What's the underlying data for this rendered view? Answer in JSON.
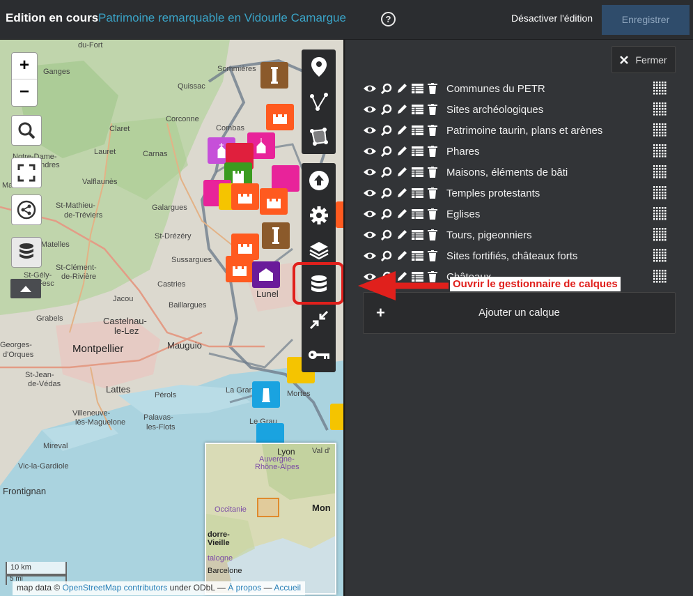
{
  "topbar": {
    "edition_label": "Edition en cours",
    "project_name": "Patrimoine remarquable en Vidourle Camargue",
    "help_label": "?",
    "disable_edit_label": "Désactiver l'édition",
    "save_label": "Enregistrer"
  },
  "map": {
    "zoom_in_label": "+",
    "zoom_out_label": "−",
    "places": [
      {
        "name": "du-Fort"
      },
      {
        "name": "Ganges"
      },
      {
        "name": "Quissac"
      },
      {
        "name": "Claret"
      },
      {
        "name": "Corconne"
      },
      {
        "name": "Combas"
      },
      {
        "name": "Lauret"
      },
      {
        "name": "Carnas"
      },
      {
        "name": "Notre-Dame-"
      },
      {
        "name": "de-Londres"
      },
      {
        "name": "Valflaunès"
      },
      {
        "name": "Martin-"
      },
      {
        "name": "St-Mathieu-"
      },
      {
        "name": "de-Tréviers"
      },
      {
        "name": "Galargues"
      },
      {
        "name": "St-Drézéry"
      },
      {
        "name": "Les Matelles"
      },
      {
        "name": "St-Clément-"
      },
      {
        "name": "de-Rivière"
      },
      {
        "name": "St-Gély-"
      },
      {
        "name": "du-Fesc"
      },
      {
        "name": "Sussargues"
      },
      {
        "name": "Castries"
      },
      {
        "name": "Jacou"
      },
      {
        "name": "Baillargues"
      },
      {
        "name": "Grabels"
      },
      {
        "name": "Castelnau-"
      },
      {
        "name": "le-Lez"
      },
      {
        "name": "Lunel"
      },
      {
        "name": "Montpellier"
      },
      {
        "name": "Mauguio"
      },
      {
        "name": "Georges-"
      },
      {
        "name": "d'Orques"
      },
      {
        "name": "St-Jean-"
      },
      {
        "name": "de-Védas"
      },
      {
        "name": "Lattes"
      },
      {
        "name": "Pérols"
      },
      {
        "name": "La Grande"
      },
      {
        "name": "Villeneuve-"
      },
      {
        "name": "lès-Maguelone"
      },
      {
        "name": "Palavas-"
      },
      {
        "name": "les-Flots"
      },
      {
        "name": "Le Grau"
      },
      {
        "name": "Mireval"
      },
      {
        "name": "Vic-la-Gardiole"
      },
      {
        "name": "Frontignan"
      },
      {
        "name": "Mortes"
      },
      {
        "name": "Sommières"
      }
    ],
    "minimap": {
      "places": [
        "Lyon",
        "Auvergne-",
        "Rhône-Alpes",
        "Val d'",
        "Occitanie",
        "Mon",
        "dorre-",
        "Vieille",
        "talogne",
        "Barcelone"
      ]
    },
    "scale_label": "10 km",
    "scale_label_2": "5 mi",
    "attribution": {
      "prefix": "map data ©",
      "osm": "OpenStreetMap contributors",
      "middle": "under ODbL —",
      "about": "À propos",
      "dash": "—",
      "home": "Accueil"
    }
  },
  "panel": {
    "close_label": "Fermer",
    "layers": [
      {
        "name": "Communes du PETR"
      },
      {
        "name": "Sites archéologiques"
      },
      {
        "name": "Patrimoine taurin, plans et arènes"
      },
      {
        "name": "Phares"
      },
      {
        "name": "Maisons, éléments de bâti"
      },
      {
        "name": "Temples protestants"
      },
      {
        "name": "Eglises"
      },
      {
        "name": "Tours, pigeonniers"
      },
      {
        "name": "Sites fortifiés, châteaux forts"
      },
      {
        "name": "Châteaux"
      }
    ],
    "add_layer_label": "Ajouter un calque",
    "add_plus": "+"
  },
  "annotation": {
    "label": "Ouvrir le gestionnaire de calques",
    "color": "#e0201c"
  },
  "colors": {
    "project_link": "#3aa3c6",
    "save_bg": "#2f4c6b",
    "panel_bg": "#323437",
    "toolbar_bg": "#2a2b2d"
  }
}
